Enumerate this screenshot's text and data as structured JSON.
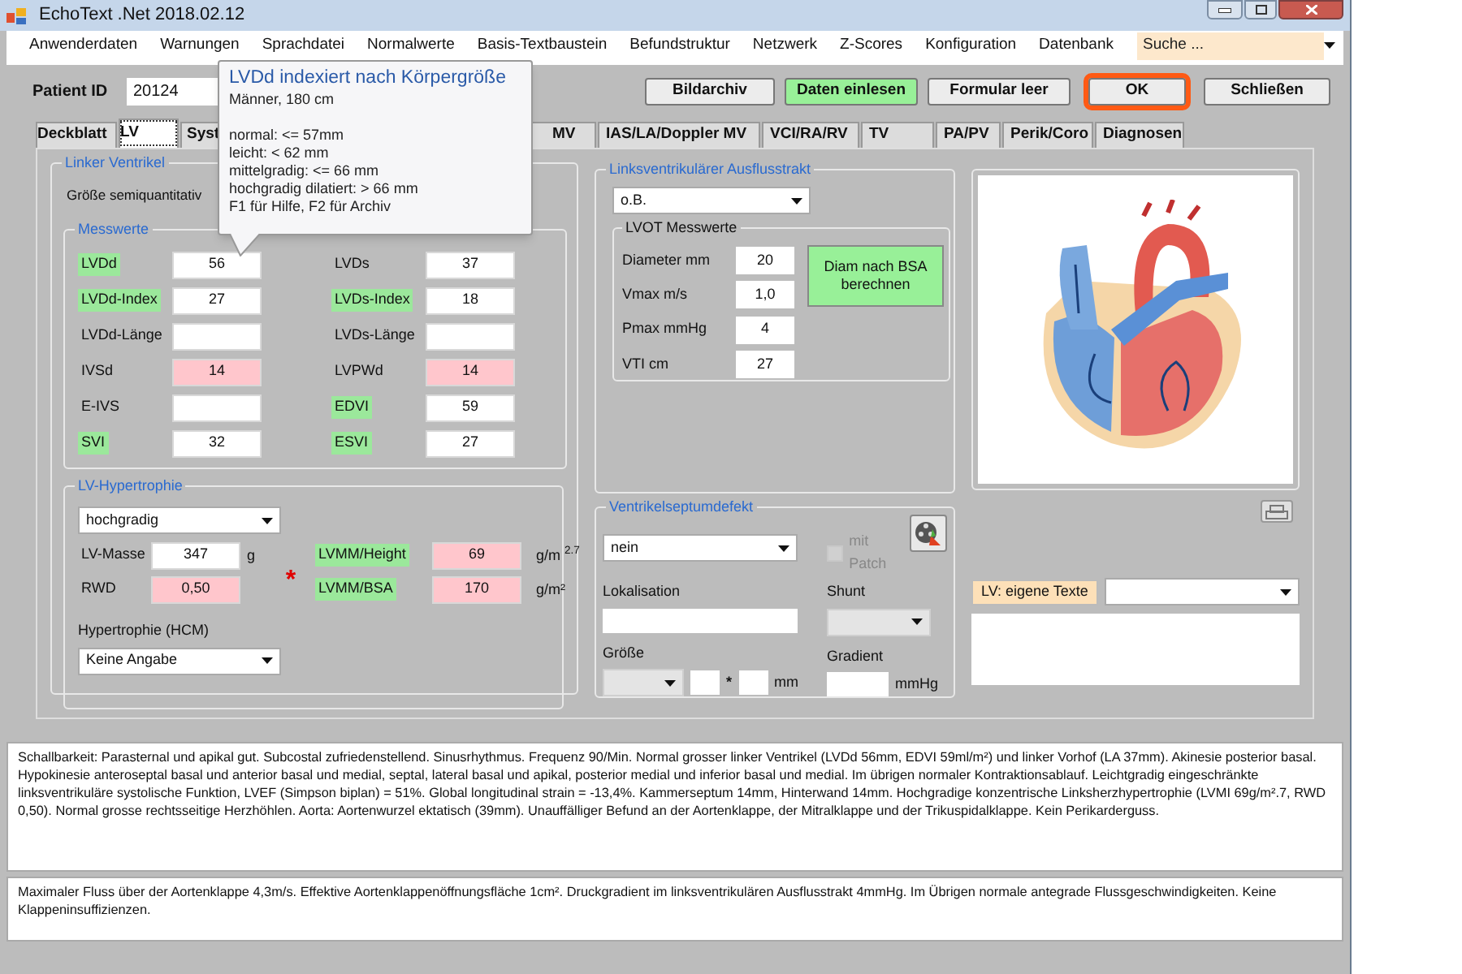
{
  "window": {
    "title": "EchoText .Net 2018.02.12"
  },
  "menu": {
    "items": [
      "Anwenderdaten",
      "Warnungen",
      "Sprachdatei",
      "Normalwerte",
      "Basis-Textbaustein",
      "Befundstruktur",
      "Netzwerk",
      "Z-Scores",
      "Konfiguration",
      "Datenbank"
    ],
    "search_placeholder": "Suche ..."
  },
  "patient": {
    "label": "Patient ID",
    "value": "20124"
  },
  "buttons": [
    {
      "label": "Bildarchiv",
      "kind": "normal"
    },
    {
      "label": "Daten einlesen",
      "kind": "green"
    },
    {
      "label": "Formular leer",
      "kind": "normal"
    },
    {
      "label": "OK",
      "kind": "highlighted"
    },
    {
      "label": "Schließen",
      "kind": "normal"
    }
  ],
  "tabs": [
    {
      "label": "Deckblatt",
      "selected": false
    },
    {
      "label": "LV",
      "selected": true
    },
    {
      "label": "Syst",
      "selected": false
    },
    {
      "label": "MV",
      "selected": false
    },
    {
      "label": "IAS/LA/Doppler MV",
      "selected": false
    },
    {
      "label": "VCI/RA/RV",
      "selected": false
    },
    {
      "label": "TV",
      "selected": false
    },
    {
      "label": "PA/PV",
      "selected": false
    },
    {
      "label": "Perik/Coro",
      "selected": false
    },
    {
      "label": "Diagnosen",
      "selected": false
    }
  ],
  "tooltip": {
    "title": "LVDd indexiert nach Körpergröße",
    "subtitle": "Männer, 180 cm",
    "lines": [
      "normal: <= 57mm",
      "leicht: < 62 mm",
      "mittelgradig: <= 66 mm",
      "hochgradig dilatiert: > 66 mm",
      "F1 für Hilfe, F2 für Archiv"
    ]
  },
  "lv": {
    "title": "Linker Ventrikel",
    "size_label": "Größe semiquantitativ",
    "measurements": {
      "title": "Messwerte",
      "fields": [
        {
          "label": "LVDd",
          "value": "56",
          "label_marked": true,
          "abnormal": false
        },
        {
          "label": "LVDs",
          "value": "37",
          "label_marked": false,
          "abnormal": false
        },
        {
          "label": "LVDd-Index",
          "value": "27",
          "label_marked": true,
          "abnormal": false
        },
        {
          "label": "LVDs-Index",
          "value": "18",
          "label_marked": true,
          "abnormal": false
        },
        {
          "label": "LVDd-Länge",
          "label_marked": false,
          "abnormal": false
        },
        {
          "label": "LVDs-Länge",
          "label_marked": false,
          "abnormal": false
        },
        {
          "label": "IVSd",
          "value": "14",
          "label_marked": false,
          "abnormal": true
        },
        {
          "label": "LVPWd",
          "value": "14",
          "label_marked": false,
          "abnormal": true
        },
        {
          "label": "E-IVS",
          "label_marked": false,
          "abnormal": false
        },
        {
          "label": "EDVI",
          "value": "59",
          "label_marked": true,
          "abnormal": false
        },
        {
          "label": "SVI",
          "value": "32",
          "label_marked": true,
          "abnormal": false
        },
        {
          "label": "ESVI",
          "value": "27",
          "label_marked": true,
          "abnormal": false
        }
      ]
    },
    "hypertrophy": {
      "title": "LV-Hypertrophie",
      "grade": "hochgradig",
      "marker": "*",
      "fields": [
        {
          "label": "LV-Masse",
          "value": "347",
          "unit": "g",
          "label_marked": false,
          "abnormal": false
        },
        {
          "label": "LVMM/Height",
          "value": "69",
          "unit": "g/m $^{2.7}$",
          "label_marked": true,
          "abnormal": true
        },
        {
          "label": "RWD",
          "value": "0,50",
          "label_marked": false,
          "abnormal": true
        },
        {
          "label": "LVMM/BSA",
          "value": "170",
          "unit": "g/m²",
          "label_marked": true,
          "abnormal": true
        }
      ],
      "hcm_label": "Hypertrophie (HCM)",
      "hcm_value": "Keine Angabe"
    }
  },
  "lvot": {
    "title": "Linksventrikulärer Ausflusstrakt",
    "value": "o.B.",
    "sub_title": "LVOT Messwerte",
    "fields": [
      {
        "label": "Diameter mm",
        "value": "20"
      },
      {
        "label": "Vmax m/s",
        "value": "1,0"
      },
      {
        "label": "Pmax mmHg",
        "value": "4"
      },
      {
        "label": "VTI cm",
        "value": "27"
      }
    ],
    "button": "Diam nach BSA berechnen"
  },
  "vsd": {
    "title": "Ventrikelseptumdefekt",
    "value": "nein",
    "patch": {
      "label": "mit Patch",
      "checked": false,
      "disabled": true
    },
    "location_label": "Lokalisation",
    "shunt_label": "Shunt",
    "size_label": "Größe",
    "times": "*",
    "mm": "mm",
    "gradient_label": "Gradient",
    "gradient_unit": "mmHg"
  },
  "custom_texts": {
    "button": "LV: eigene Texte"
  },
  "reports": [
    "Schallbarkeit: Parasternal und apikal gut. Subcostal zufriedenstellend. Sinusrhythmus. Frequenz 90/Min. Normal grosser linker Ventrikel (LVDd 56mm, EDVI 59ml/m²) und linker Vorhof (LA 37mm). Akinesie posterior basal. Hypokinesie anteroseptal basal und anterior basal und medial, septal, lateral basal und apikal, posterior medial und inferior basal und medial. Im übrigen normaler Kontraktionsablauf. Leichtgradig eingeschränkte linksventrikuläre systolische Funktion, LVEF (Simpson biplan) = 51%. Global longitudinal strain = -13,4%. Kammerseptum 14mm, Hinterwand 14mm. Hochgradige konzentrische Linksherzhypertrophie (LVMI 69g/m².7, RWD 0,50). Normal grosse rechtsseitige Herzhöhlen. Aorta: Aortenwurzel ektatisch (39mm). Unauffälliger Befund an der Aortenklappe, der Mitralklappe und der Trikuspidalklappe. Kein Perikarderguss.",
    "Maximaler Fluss über der Aortenklappe 4,3m/s. Effektive Aortenklappenöffnungsfläche 1cm². Druckgradient im linksventrikulären Ausflusstrakt 4mmHg. Im Übrigen normale antegrade Flussgeschwindigkeiten. Keine Klappeninsuffizienzen."
  ]
}
